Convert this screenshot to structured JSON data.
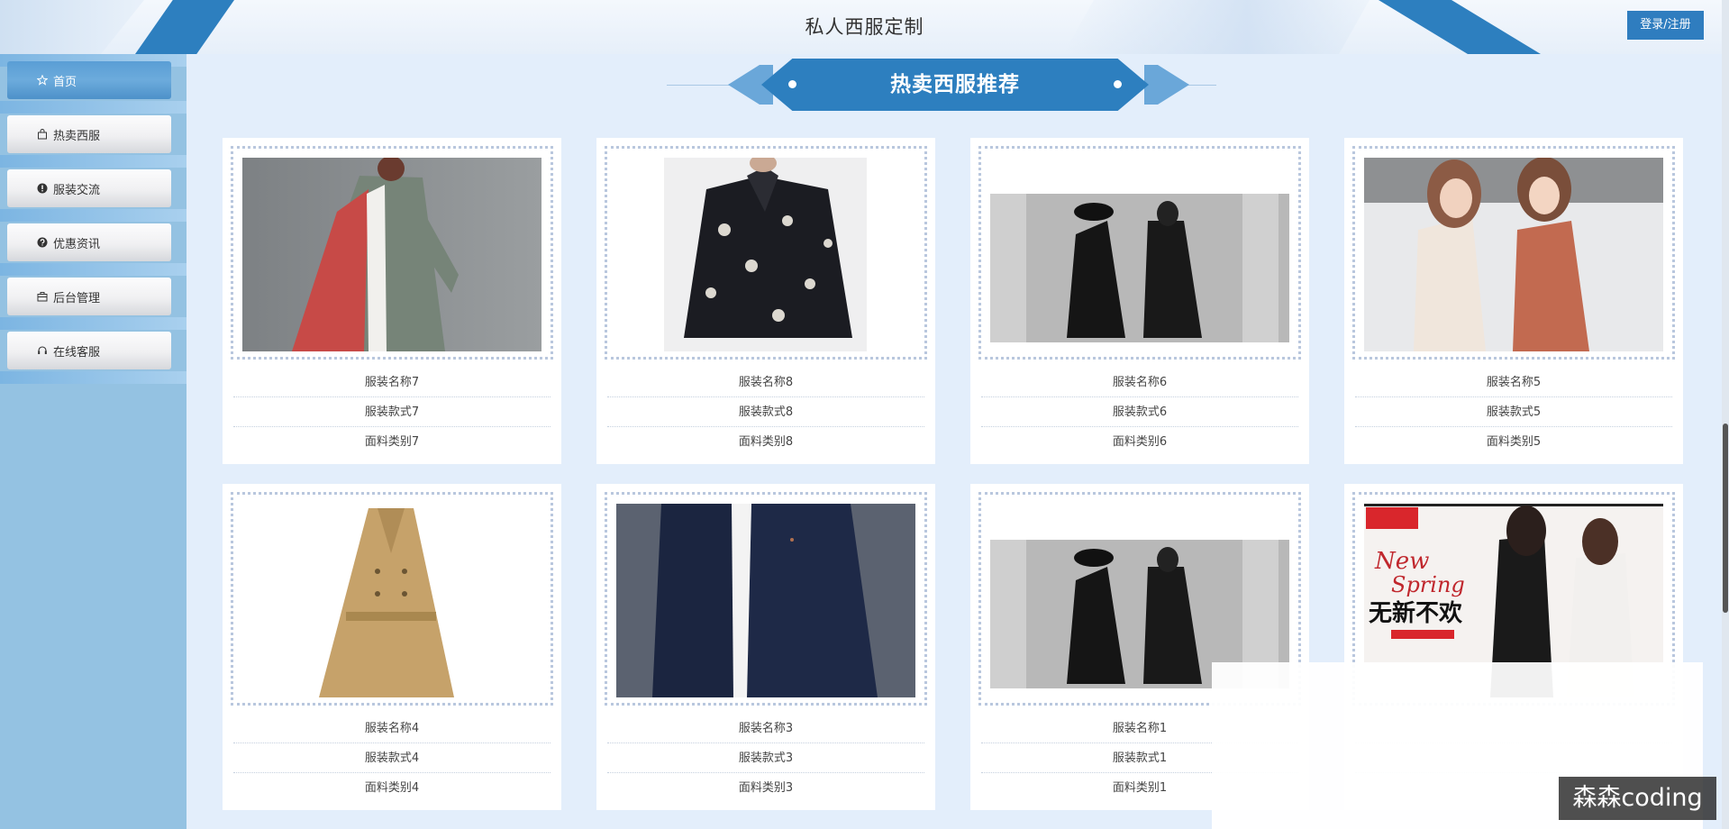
{
  "header": {
    "title": "私人西服定制",
    "login_label": "登录/注册"
  },
  "sidebar": {
    "items": [
      {
        "label": "首页",
        "icon": "star-icon"
      },
      {
        "label": "热卖西服",
        "icon": "bag-icon"
      },
      {
        "label": "服装交流",
        "icon": "info-circle-icon"
      },
      {
        "label": "优惠资讯",
        "icon": "question-circle-icon"
      },
      {
        "label": "后台管理",
        "icon": "briefcase-icon"
      },
      {
        "label": "在线客服",
        "icon": "headset-icon"
      }
    ]
  },
  "section": {
    "title": "热卖西服推荐"
  },
  "products": [
    {
      "name": "服装名称7",
      "style": "服装款式7",
      "fabric": "面料类别7"
    },
    {
      "name": "服装名称8",
      "style": "服装款式8",
      "fabric": "面料类别8"
    },
    {
      "name": "服装名称6",
      "style": "服装款式6",
      "fabric": "面料类别6"
    },
    {
      "name": "服装名称5",
      "style": "服装款式5",
      "fabric": "面料类别5"
    },
    {
      "name": "服装名称4",
      "style": "服装款式4",
      "fabric": "面料类别4"
    },
    {
      "name": "服装名称3",
      "style": "服装款式3",
      "fabric": "面料类别3"
    },
    {
      "name": "服装名称1",
      "style": "服装款式1",
      "fabric": "面料类别1"
    },
    {
      "name": "",
      "style": "",
      "fabric": ""
    }
  ],
  "poster_text": {
    "brand_badge": "",
    "line1": "New",
    "line2": "Spring",
    "line3": "无新不欢"
  },
  "watermark": "森森coding",
  "colors": {
    "accent": "#2d7fbf",
    "sidebar_bg": "#94c2e2",
    "page_bg": "#e3eefb"
  }
}
